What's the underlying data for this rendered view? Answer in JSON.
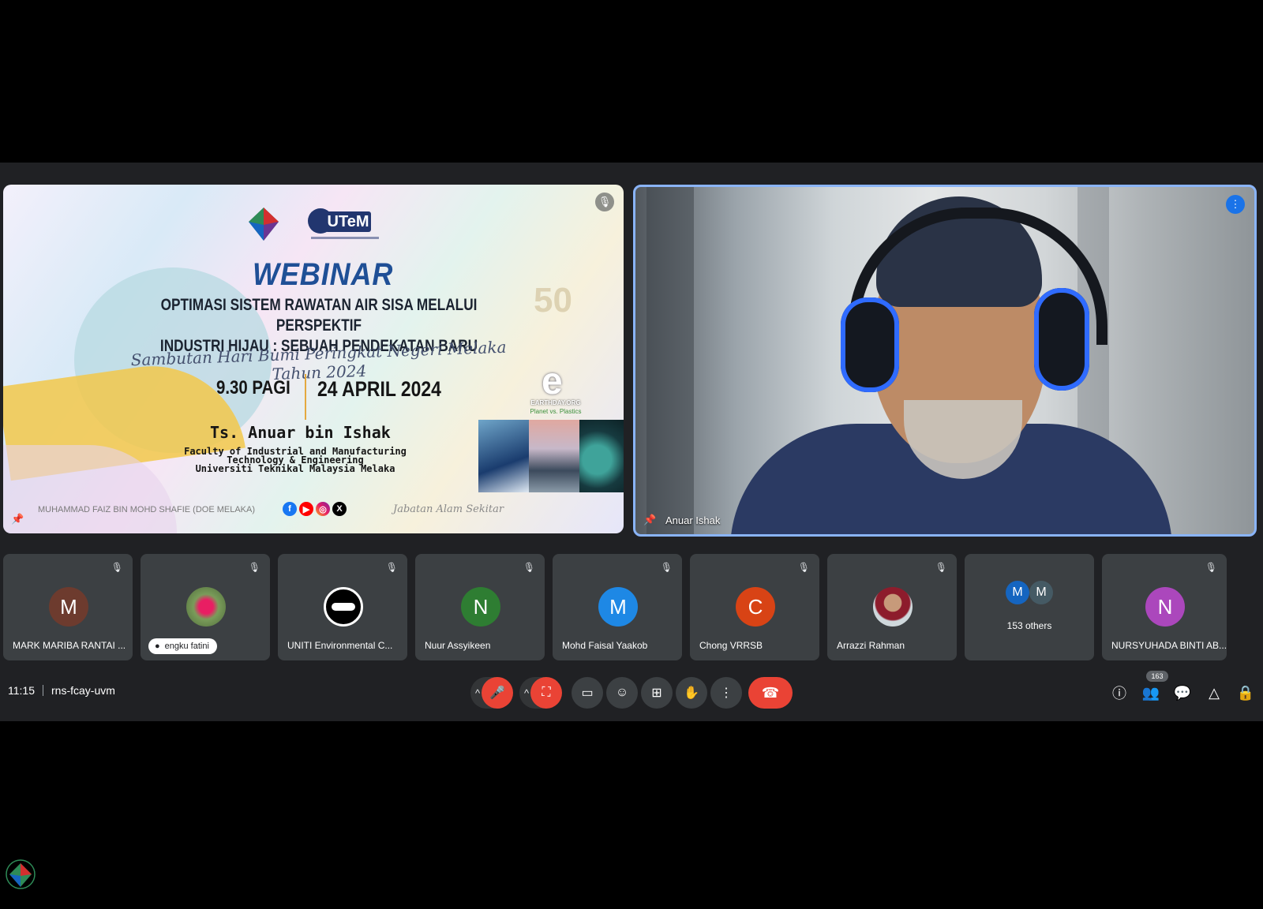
{
  "presentation": {
    "presenter_label": "MUHAMMAD FAIZ BIN MOHD SHAFIE (DOE MELAKA)",
    "poster": {
      "brand": "UTeM",
      "heading": "WEBINAR",
      "title_line1": "OPTIMASI SISTEM RAWATAN AIR SISA MELALUI PERSPEKTIF",
      "title_line2": "INDUSTRI HIJAU : SEBUAH PENDEKATAN BARU",
      "event_script": "Sambutan Hari Bumi Peringkat Negeri Melaka Tahun 2024",
      "time": "9.30 PAGI",
      "date": "24 APRIL 2024",
      "speaker": "Ts. Anuar bin Ishak",
      "faculty_line1": "Faculty of Industrial and Manufacturing",
      "faculty_line2": "Technology & Engineering",
      "faculty_line3": "Universiti Teknikal Malaysia Melaka",
      "anniversary": "50",
      "earthday_mark": "e",
      "earthday_name": "EARTHDAY.ORG",
      "earthday_sub": "Planet vs. Plastics",
      "signature": "Jabatan Alam Sekitar"
    }
  },
  "speaker_tile": {
    "name": "Anuar Ishak"
  },
  "participants": [
    {
      "initial": "M",
      "name": "MARK MARIBA RANTAI ...",
      "color": "#6d3b2e"
    },
    {
      "initial": "",
      "name": "engku fatini",
      "color": "#7a9c5a"
    },
    {
      "initial": "",
      "name": "UNITI Environmental C...",
      "color": "#ffffff"
    },
    {
      "initial": "N",
      "name": "Nuur Assyikeen",
      "color": "#2e7d32"
    },
    {
      "initial": "M",
      "name": "Mohd Faisal Yaakob",
      "color": "#1e88e5"
    },
    {
      "initial": "C",
      "name": "Chong VRRSB",
      "color": "#d84315"
    },
    {
      "initial": "",
      "name": "Arrazzi Rahman",
      "color": "#8d6e63"
    },
    {
      "initial": "N",
      "name": "NURSYUHADA BINTI AB...",
      "color": "#ab47bc"
    }
  ],
  "others_tile": {
    "label": "153 others",
    "initial_a": "M",
    "initial_b": "M",
    "color_a": "#1565c0",
    "color_b": "#455a64"
  },
  "bottom_bar": {
    "time": "11:15",
    "meeting_code": "rns-fcay-uvm",
    "participant_count": "163"
  },
  "colors": {
    "accent": "#8ab4f8",
    "danger": "#ea4335",
    "bg": "#202124",
    "tile": "#3c4043"
  },
  "icons": [
    "mic-off-icon",
    "camera-off-icon",
    "captions-icon",
    "emoji-icon",
    "present-icon",
    "raise-hand-icon",
    "more-icon",
    "hang-up-icon",
    "info-icon",
    "people-icon",
    "chat-icon",
    "activities-icon",
    "host-controls-icon"
  ]
}
